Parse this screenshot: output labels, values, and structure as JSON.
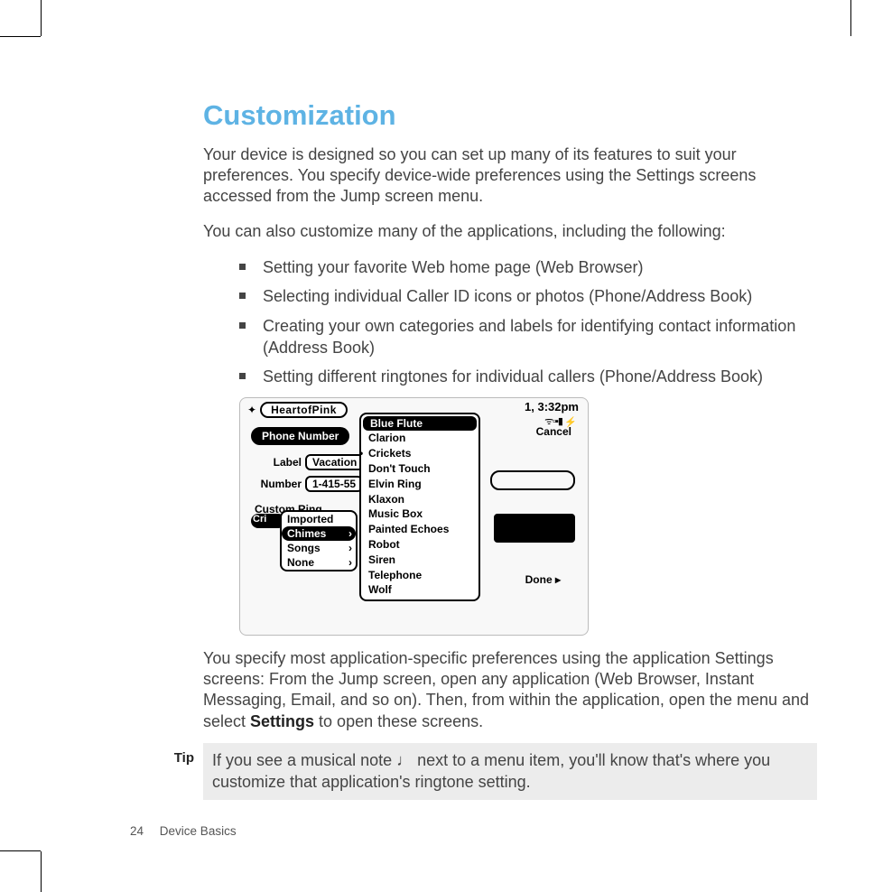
{
  "heading": "Customization",
  "intro": "Your device is designed so you can set up many of its features to suit your preferences. You specify device-wide preferences using the Settings screens accessed from the Jump screen menu.",
  "lead": "You can also customize many of the applications, including the following:",
  "bullets": [
    "Setting your favorite Web home page (Web Browser)",
    "Selecting individual Caller ID icons or photos (Phone/Address Book)",
    "Creating your own categories and labels for identifying contact information (Address Book)",
    "Setting different ringtones for individual callers (Phone/Address Book)"
  ],
  "screen": {
    "title": "HeartofPink",
    "clock": "1, 3:32pm",
    "section": "Phone Number",
    "label_caption": "Label",
    "label_value": "Vacation",
    "number_caption": "Number",
    "number_value": "1-415-55",
    "custom_ring": "Custom Ring",
    "cri": "Cri",
    "left_menu": [
      "Imported",
      "Chimes",
      "Songs",
      "None"
    ],
    "left_selected": "Chimes",
    "right_menu": [
      "Blue Flute",
      "Clarion",
      "Crickets",
      "Don't Touch",
      "Elvin Ring",
      "Klaxon",
      "Music Box",
      "Painted Echoes",
      "Robot",
      "Siren",
      "Telephone",
      "Wolf"
    ],
    "right_selected": "Blue Flute",
    "right_dotted": "Crickets",
    "cancel": "Cancel",
    "done": "Done"
  },
  "after_para_pre": "You specify most application-specific preferences using the application Settings screens: From the Jump screen, open any application (Web Browser, Instant Messaging, Email, and so on). Then, from within the application, open the menu and select ",
  "after_para_bold": "Settings",
  "after_para_post": " to open these screens.",
  "tip_label": "Tip",
  "tip_pre": "If you see a musical note ",
  "tip_post": " next to a menu item, you'll know that's where you customize that application's ringtone setting.",
  "footer": {
    "page": "24",
    "section": "Device Basics"
  }
}
